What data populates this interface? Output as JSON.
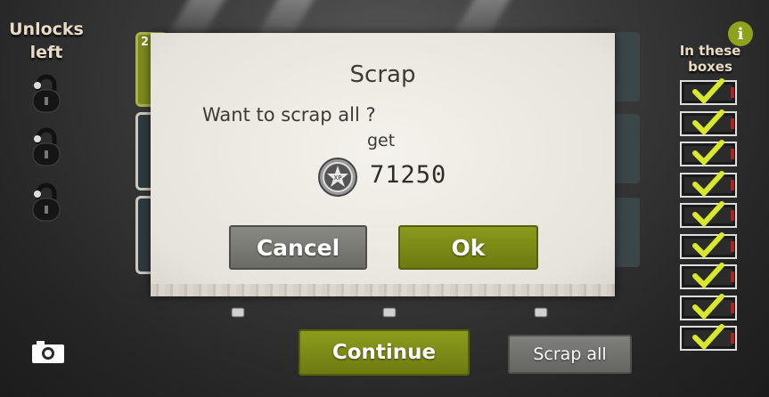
{
  "sidebar": {
    "unlocks_title": "Unlocks left",
    "boxes_title": "In these boxes",
    "lock_icons": [
      "lock-icon",
      "lock-icon",
      "lock-icon"
    ],
    "box_checks": 9
  },
  "card_count": "2",
  "dialog": {
    "title": "Scrap",
    "question": "Want to scrap all ?",
    "get_label": "get",
    "reward_amount": "71250",
    "reward_icon": "xp-coin-icon",
    "cancel_label": "Cancel",
    "ok_label": "Ok"
  },
  "footer": {
    "continue_label": "Continue",
    "scrap_all_label": "Scrap all"
  },
  "colors": {
    "accent_green": "#7c8a12",
    "button_grey": "#6f6f6b",
    "check_yellow": "#d8e82a"
  },
  "icons": {
    "info": "info-icon",
    "camera": "camera-icon",
    "check": "checkmark-icon"
  }
}
